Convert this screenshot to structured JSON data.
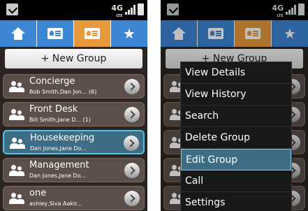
{
  "status_bar": {
    "network_label": "4G",
    "network_sub": "LTE",
    "icons": [
      "notification-icon",
      "signal-icon",
      "battery-icon"
    ]
  },
  "tabs": [
    {
      "icon": "home-icon",
      "active": false
    },
    {
      "icon": "contacts-card-icon",
      "active": false
    },
    {
      "icon": "groups-card-icon",
      "active": true
    },
    {
      "icon": "star-icon",
      "active": false
    }
  ],
  "new_group_label": "+ New Group",
  "groups": [
    {
      "name": "Concierge",
      "members": "Bob Smith,Dan Jon... (6)"
    },
    {
      "name": "Front Desk",
      "members": "Bill Smith,Jane D... (1)"
    },
    {
      "name": "Housekeeping",
      "members": "Dan Jones,Jane Do...",
      "selected": true
    },
    {
      "name": "Management",
      "members": "Dan Jones,Jane Do..."
    },
    {
      "name": "one",
      "members": "ashley,Siva Aakir..."
    }
  ],
  "context_menu": {
    "items": [
      {
        "label": "View Details"
      },
      {
        "label": "View History"
      },
      {
        "label": "Search"
      },
      {
        "label": "Delete Group"
      },
      {
        "label": "Edit Group",
        "highlighted": true
      },
      {
        "label": "Call"
      },
      {
        "label": "Settings"
      }
    ]
  },
  "colors": {
    "tab_blue": "#3d86d4",
    "tab_orange": "#e79a3c",
    "row_bg": "#5c4f49",
    "selected_bg": "#3d6d84",
    "selected_border": "#5ac0e0"
  }
}
